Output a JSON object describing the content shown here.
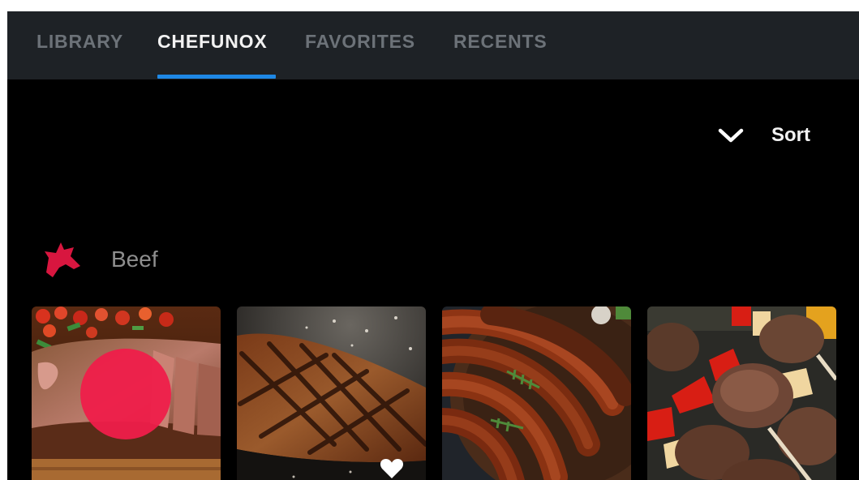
{
  "tabs": [
    {
      "label": "LIBRARY",
      "active": false
    },
    {
      "label": "CHEFUNOX",
      "active": true
    },
    {
      "label": "FAVORITES",
      "active": false
    },
    {
      "label": "RECENTS",
      "active": false
    }
  ],
  "sort": {
    "label": "Sort",
    "icon": "chevron-down-icon"
  },
  "category": {
    "title": "Beef",
    "icon": "cow-head-icon",
    "icon_color": "#d8163f"
  },
  "cards": [
    {
      "photo": "sliced-steak-photo",
      "favorited": false
    },
    {
      "photo": "grilled-steak-photo",
      "favorited": true
    },
    {
      "photo": "sausages-photo",
      "favorited": false
    },
    {
      "photo": "beef-skewers-photo",
      "favorited": false
    }
  ],
  "colors": {
    "tabbar_background": "#1e2226",
    "active_tab_text": "#f2f2f2",
    "inactive_tab_text": "#6c7278",
    "tab_indicator": "#1e88e5",
    "accent_red": "#ef1d4a"
  }
}
